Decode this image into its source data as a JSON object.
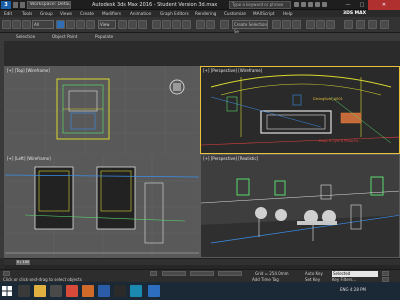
{
  "titlebar": {
    "logo": "3",
    "workspace": "Workspace: Default",
    "window_title": "Autodesk 3ds Max 2016 - Student Version   3d.max",
    "search_placeholder": "Type a keyword or phrase",
    "min": "—",
    "max": "□",
    "close": "✕"
  },
  "menubar": {
    "items": [
      "Edit",
      "Tools",
      "Group",
      "Views",
      "Create",
      "Modifiers",
      "Animation",
      "Graph Editors",
      "Rendering",
      "Customize",
      "MAXScript",
      "Help"
    ],
    "app_label": "3DS MAX"
  },
  "toolbar": {
    "select_filter": "All",
    "view_dropdown": "View",
    "named_selection_placeholder": "Create Selection Se"
  },
  "ribbon": {
    "tabs": [
      "Selection",
      "Object Paint",
      "Populate"
    ]
  },
  "viewports": {
    "top_left_label": "[+] [Top] [Wireframe]",
    "top_right_label": "[+] [Perspective] [Wireframe]",
    "bottom_left_label": "[+] [Left] [Wireframe]",
    "bottom_right_label": "[+] [Perspective] [Realistic]",
    "object_label_1": "DiningSofa_A001",
    "object_label_2": "Polys: 8 Gym & Pillow Rt..."
  },
  "timeline": {
    "thumb": "0 / 100",
    "frame_readout": "0 / 100"
  },
  "statusbar": {
    "prompt": "Click or click-and-drag to select objects",
    "add_time_tag": "Add Time Tag",
    "grid": "Grid = 254.0mm",
    "auto_key": "Auto Key",
    "set_key": "Set Key",
    "selected": "Selected",
    "key_filters": "Key Filters..."
  },
  "taskbar": {
    "tray_text": "ENG  4:28 PM"
  },
  "colors": {
    "active_viewport_border": "#e8c23a",
    "wireframe_yellow": "#d8d830",
    "wireframe_green": "#58d86a",
    "wireframe_blue": "#3a8ee8",
    "wireframe_white": "#e0e0e0",
    "wireframe_red": "#e04040"
  }
}
